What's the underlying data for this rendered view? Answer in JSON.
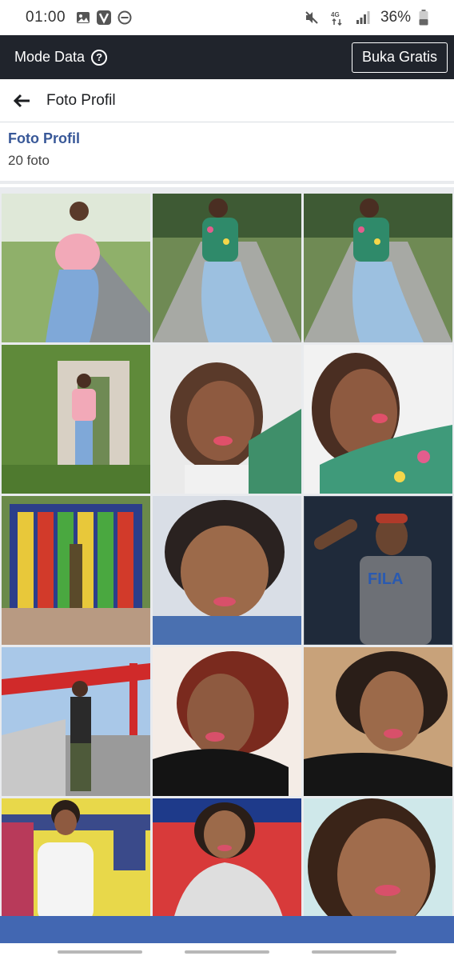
{
  "status_bar": {
    "time": "01:00",
    "left_icons": [
      "gallery-icon",
      "v-app-icon",
      "dnd-icon"
    ],
    "right_icons": [
      "mute-icon",
      "4g-data-icon",
      "signal-icon"
    ],
    "network": "4G",
    "battery": "36%"
  },
  "data_bar": {
    "label": "Mode Data",
    "help": "?",
    "free_button": "Buka Gratis"
  },
  "header": {
    "title": "Foto Profil"
  },
  "album": {
    "title": "Foto Profil",
    "count": "20 foto"
  },
  "photos": [
    {
      "scene": "woman-on-road-pink-jacket"
    },
    {
      "scene": "woman-on-road-floral-shirt"
    },
    {
      "scene": "woman-on-road-floral-shirt"
    },
    {
      "scene": "woman-at-gate-pink-jacket"
    },
    {
      "scene": "selfie-white-shirt"
    },
    {
      "scene": "selfie-floral-shirt"
    },
    {
      "scene": "colorful-bottle-gate-soldier"
    },
    {
      "scene": "selfie-blue-shirt"
    },
    {
      "scene": "man-fila-shirt"
    },
    {
      "scene": "soldier-on-red-bridge"
    },
    {
      "scene": "selfie-black-top"
    },
    {
      "scene": "selfie-black-top-wind"
    },
    {
      "scene": "woman-white-shirt-yellow-house"
    },
    {
      "scene": "woman-grey-jacket-red-wall"
    },
    {
      "scene": "selfie-close-up"
    }
  ],
  "colors": {
    "top_bar": "#20242c",
    "link_blue": "#385898",
    "bottom_bar": "#4267b2",
    "grid_bg": "#e9ebee"
  }
}
